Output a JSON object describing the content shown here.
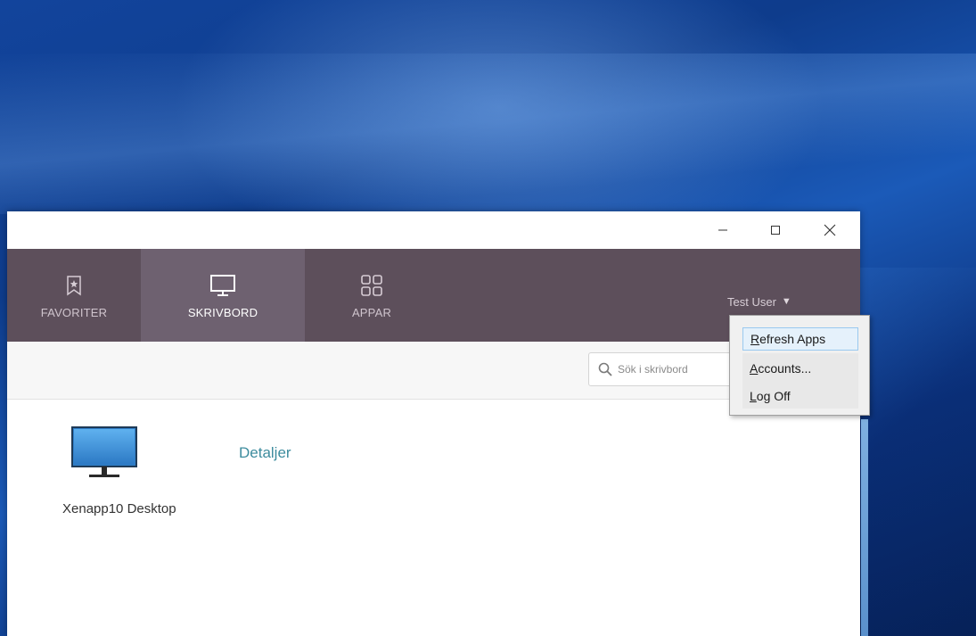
{
  "window": {
    "controls": {
      "minimize_icon": "minimize-icon",
      "maximize_icon": "maximize-icon",
      "close_icon": "close-icon"
    }
  },
  "nav": {
    "tabs": [
      {
        "label": "FAVORITER",
        "icon": "bookmark-star-icon",
        "selected": false
      },
      {
        "label": "SKRIVBORD",
        "icon": "monitor-icon",
        "selected": true
      },
      {
        "label": "APPAR",
        "icon": "app-grid-icon",
        "selected": false
      }
    ],
    "user": {
      "name": "Test User",
      "caret": "▼"
    }
  },
  "search": {
    "placeholder": "Sök i skrivbord",
    "icon": "search-icon"
  },
  "content": {
    "items": [
      {
        "name": "Xenapp10 Desktop",
        "icon": "desktop-monitor-icon",
        "details_label": "Detaljer"
      }
    ]
  },
  "user_dropdown": {
    "items": [
      {
        "accel": "R",
        "rest": "efresh Apps",
        "highlighted": true
      },
      {
        "accel": "A",
        "rest": "ccounts...",
        "highlighted": false
      },
      {
        "accel": "L",
        "rest": "og Off",
        "highlighted": false
      }
    ]
  },
  "colors": {
    "nav_bg": "#5d4f5b",
    "nav_selected_bg": "#6e6170",
    "link": "#3d8c9e",
    "desktop_bg": "#0e3c8c"
  }
}
